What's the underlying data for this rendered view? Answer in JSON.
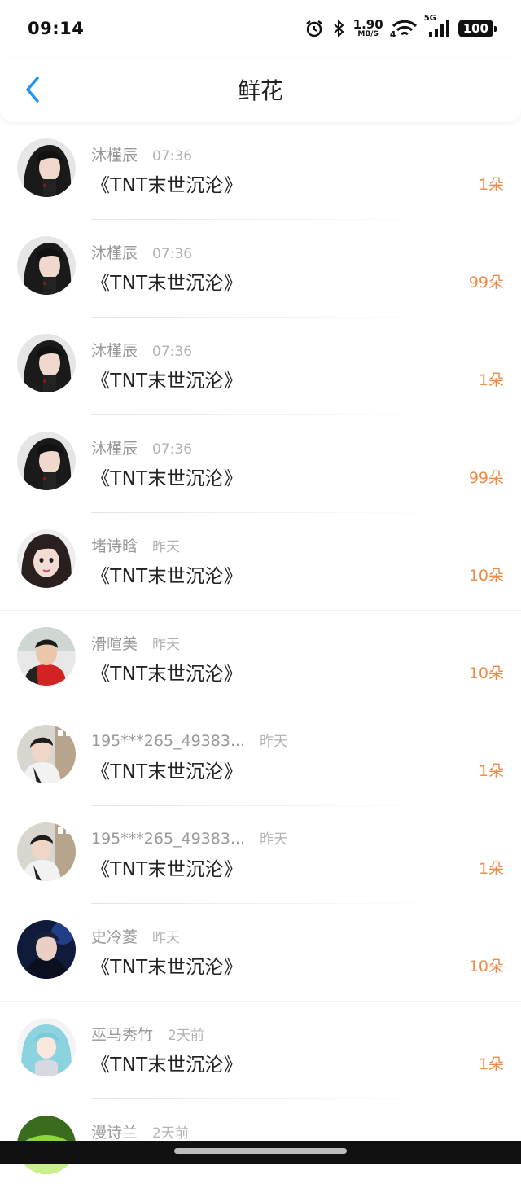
{
  "status_bar": {
    "time": "09:14",
    "net_speed_value": "1.90",
    "net_speed_unit": "MB/S",
    "network": "5G",
    "wifi_badge": "4",
    "battery": "100"
  },
  "header": {
    "title": "鲜花"
  },
  "colors": {
    "accent": "#2196f3",
    "count": "#f08a44"
  },
  "items": [
    {
      "user": "沐槿辰",
      "time": "07:36",
      "title": "《TNT末世沉沦》",
      "count": "1朵",
      "avatar": "dark-hair-portrait"
    },
    {
      "user": "沐槿辰",
      "time": "07:36",
      "title": "《TNT末世沉沦》",
      "count": "99朵",
      "avatar": "dark-hair-portrait"
    },
    {
      "user": "沐槿辰",
      "time": "07:36",
      "title": "《TNT末世沉沦》",
      "count": "1朵",
      "avatar": "dark-hair-portrait"
    },
    {
      "user": "沐槿辰",
      "time": "07:36",
      "title": "《TNT末世沉沦》",
      "count": "99朵",
      "avatar": "dark-hair-portrait"
    },
    {
      "user": "堵诗晗",
      "time": "昨天",
      "title": "《TNT末世沉沦》",
      "count": "10朵",
      "avatar": "girl-portrait"
    },
    {
      "user": "滑暄美",
      "time": "昨天",
      "title": "《TNT末世沉沦》",
      "count": "10朵",
      "avatar": "boy-red-shirt"
    },
    {
      "user": "195***265_49383...",
      "time": "昨天",
      "title": "《TNT末世沉沦》",
      "count": "1朵",
      "avatar": "boy-building"
    },
    {
      "user": "195***265_49383...",
      "time": "昨天",
      "title": "《TNT末世沉沦》",
      "count": "1朵",
      "avatar": "boy-building"
    },
    {
      "user": "史冷菱",
      "time": "昨天",
      "title": "《TNT末世沉沦》",
      "count": "10朵",
      "avatar": "boy-blue-light"
    },
    {
      "user": "巫马秀竹",
      "time": "2天前",
      "title": "《TNT末世沉沦》",
      "count": "1朵",
      "avatar": "anime-blue-hair"
    },
    {
      "user": "漫诗兰",
      "time": "2天前",
      "title": "",
      "count": "",
      "avatar": "green-leaf"
    }
  ]
}
